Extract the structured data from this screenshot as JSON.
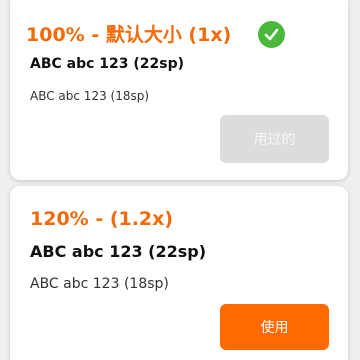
{
  "cards": [
    {
      "title": "100% - 默认大小 (1x)",
      "sample_large": "ABC abc 123 (22sp)",
      "sample_small": "ABC abc 123 (18sp)",
      "button_label": "用过的",
      "selected": true
    },
    {
      "title": "120% - (1.2x)",
      "sample_large": "ABC abc 123 (22sp)",
      "sample_small": "ABC abc 123 (18sp)",
      "button_label": "使用",
      "selected": false
    }
  ],
  "colors": {
    "accent": "#f46a0a",
    "button_active": "#ff6a00",
    "button_disabled": "#dcdcdc",
    "check": "#4ab83a"
  },
  "icons": {
    "selected": "check-circle-icon"
  }
}
